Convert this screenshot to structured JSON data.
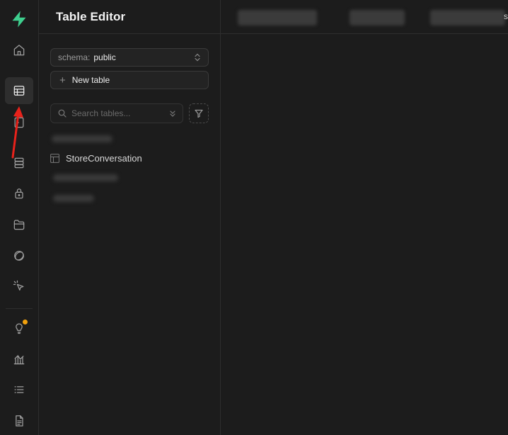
{
  "rail": {
    "items": [
      {
        "name": "home",
        "icon": "home-icon"
      },
      {
        "name": "table-editor",
        "icon": "table-icon",
        "active": true
      },
      {
        "name": "sql-editor",
        "icon": "terminal-icon"
      },
      {
        "name": "database",
        "icon": "database-icon"
      },
      {
        "name": "authentication",
        "icon": "lock-icon"
      },
      {
        "name": "storage",
        "icon": "folder-icon"
      },
      {
        "name": "realtime",
        "icon": "realtime-icon"
      },
      {
        "name": "edge-functions",
        "icon": "cursor-icon"
      },
      {
        "name": "advisors",
        "icon": "lightbulb-icon"
      },
      {
        "name": "reports",
        "icon": "chart-icon"
      },
      {
        "name": "logs",
        "icon": "list-icon"
      },
      {
        "name": "api-docs",
        "icon": "document-icon"
      }
    ],
    "accent": "#3ecf8e",
    "notify_color": "#f1a10d"
  },
  "panel": {
    "title": "Table Editor",
    "schema_label": "schema:",
    "schema_value": "public",
    "new_table_label": "New table",
    "search_placeholder": "Search tables...",
    "tables": [
      {
        "label": "StoreConversation"
      }
    ]
  },
  "header": {
    "edge_text": "s"
  },
  "annotation": {
    "arrow_color": "#e8221b"
  }
}
